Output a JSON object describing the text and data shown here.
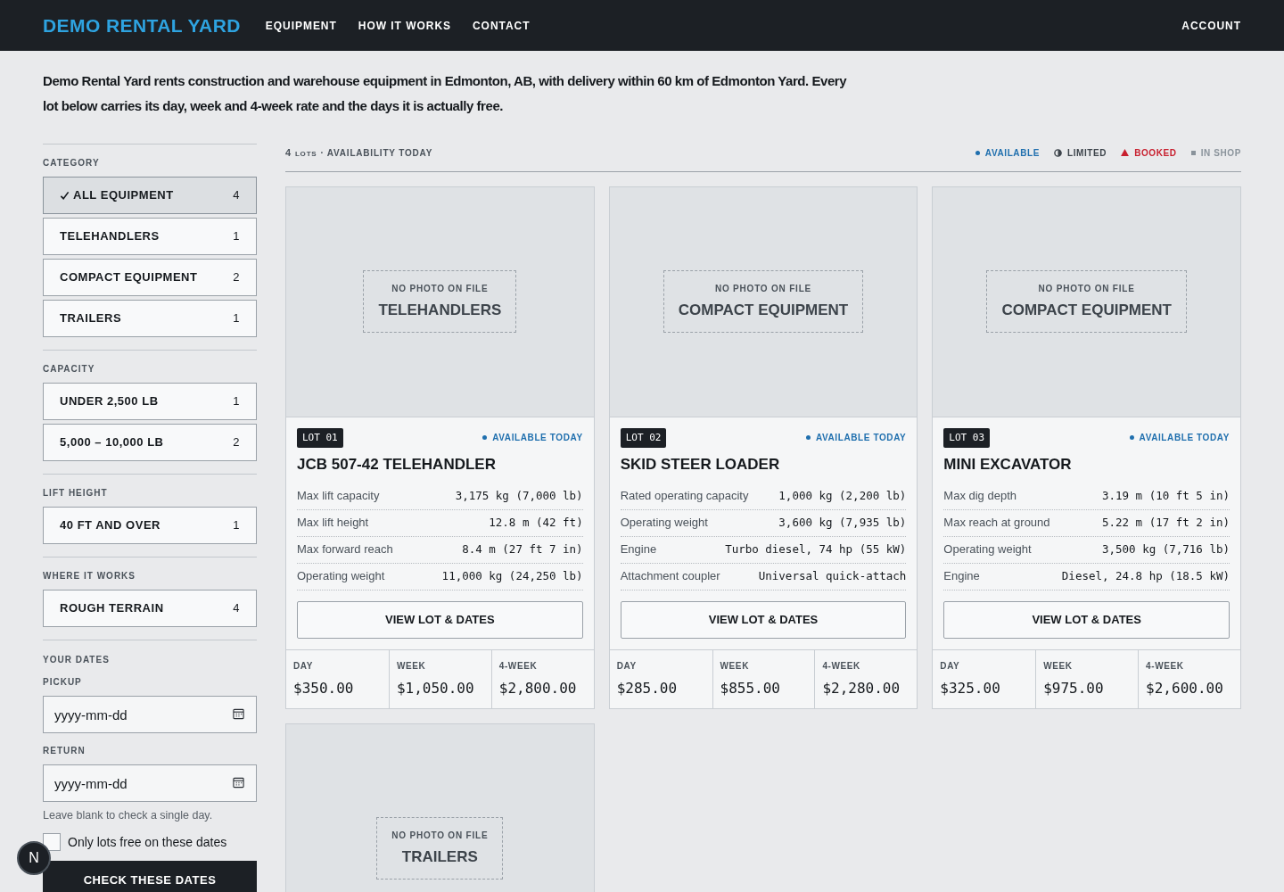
{
  "header": {
    "brand": "DEMO RENTAL YARD",
    "nav": [
      {
        "label": "EQUIPMENT"
      },
      {
        "label": "HOW IT WORKS"
      },
      {
        "label": "CONTACT"
      }
    ],
    "account": "ACCOUNT"
  },
  "intro": "Demo Rental Yard rents construction and warehouse equipment in Edmonton, AB, with delivery within 60 km of Edmonton Yard. Every lot below carries its day, week and 4-week rate and the days it is actually free.",
  "filters": [
    {
      "title": "CATEGORY",
      "options": [
        {
          "label": "ALL EQUIPMENT",
          "count": "4",
          "selected": true
        },
        {
          "label": "TELEHANDLERS",
          "count": "1",
          "selected": false
        },
        {
          "label": "COMPACT EQUIPMENT",
          "count": "2",
          "selected": false
        },
        {
          "label": "TRAILERS",
          "count": "1",
          "selected": false
        }
      ]
    },
    {
      "title": "CAPACITY",
      "options": [
        {
          "label": "UNDER 2,500 LB",
          "count": "1",
          "selected": false
        },
        {
          "label": "5,000 – 10,000 LB",
          "count": "2",
          "selected": false
        }
      ]
    },
    {
      "title": "LIFT HEIGHT",
      "options": [
        {
          "label": "40 FT AND OVER",
          "count": "1",
          "selected": false
        }
      ]
    },
    {
      "title": "WHERE IT WORKS",
      "options": [
        {
          "label": "ROUGH TERRAIN",
          "count": "4",
          "selected": false
        }
      ]
    }
  ],
  "dates": {
    "title": "YOUR DATES",
    "pickup": {
      "label": "PICKUP",
      "placeholder": "yyyy-mm-dd"
    },
    "return": {
      "label": "RETURN",
      "placeholder": "yyyy-mm-dd"
    },
    "hint": "Leave blank to check a single day.",
    "only_free": {
      "label": "Only lots free on these dates",
      "checked": false
    },
    "button": "CHECK THESE DATES"
  },
  "dev_badge": "N",
  "results": {
    "count": "4",
    "count_unit": "LOTS",
    "heading": "· AVAILABILITY TODAY",
    "legend": [
      {
        "kind": "dot",
        "label": "AVAILABLE",
        "color": "#1f6fae"
      },
      {
        "kind": "half",
        "label": "LIMITED",
        "color": "#3d444b"
      },
      {
        "kind": "triangle",
        "label": "BOOKED",
        "color": "#c8202f"
      },
      {
        "kind": "square",
        "label": "IN SHOP",
        "color": "#8a939b"
      }
    ]
  },
  "lots": [
    {
      "photo_note": "NO PHOTO ON FILE",
      "photo_category": "TELEHANDLERS",
      "lot": "LOT 01",
      "status": "AVAILABLE TODAY",
      "name": "JCB 507-42 TELEHANDLER",
      "specs": [
        {
          "label": "Max lift capacity",
          "value": "3,175 kg (7,000 lb)"
        },
        {
          "label": "Max lift height",
          "value": "12.8 m (42 ft)"
        },
        {
          "label": "Max forward reach",
          "value": "8.4 m (27 ft 7 in)"
        },
        {
          "label": "Operating weight",
          "value": "11,000 kg (24,250 lb)"
        }
      ],
      "button": "VIEW LOT & DATES",
      "rates": [
        {
          "label": "DAY",
          "price": "$350.00"
        },
        {
          "label": "WEEK",
          "price": "$1,050.00"
        },
        {
          "label": "4-WEEK",
          "price": "$2,800.00"
        }
      ]
    },
    {
      "photo_note": "NO PHOTO ON FILE",
      "photo_category": "COMPACT EQUIPMENT",
      "lot": "LOT 02",
      "status": "AVAILABLE TODAY",
      "name": "SKID STEER LOADER",
      "specs": [
        {
          "label": "Rated operating capacity",
          "value": "1,000 kg (2,200 lb)"
        },
        {
          "label": "Operating weight",
          "value": "3,600 kg (7,935 lb)"
        },
        {
          "label": "Engine",
          "value": "Turbo diesel, 74 hp (55 kW)"
        },
        {
          "label": "Attachment coupler",
          "value": "Universal quick-attach"
        }
      ],
      "button": "VIEW LOT & DATES",
      "rates": [
        {
          "label": "DAY",
          "price": "$285.00"
        },
        {
          "label": "WEEK",
          "price": "$855.00"
        },
        {
          "label": "4-WEEK",
          "price": "$2,280.00"
        }
      ]
    },
    {
      "photo_note": "NO PHOTO ON FILE",
      "photo_category": "COMPACT EQUIPMENT",
      "lot": "LOT 03",
      "status": "AVAILABLE TODAY",
      "name": "MINI EXCAVATOR",
      "specs": [
        {
          "label": "Max dig depth",
          "value": "3.19 m (10 ft 5 in)"
        },
        {
          "label": "Max reach at ground",
          "value": "5.22 m (17 ft 2 in)"
        },
        {
          "label": "Operating weight",
          "value": "3,500 kg (7,716 lb)"
        },
        {
          "label": "Engine",
          "value": "Diesel, 24.8 hp (18.5 kW)"
        }
      ],
      "button": "VIEW LOT & DATES",
      "rates": [
        {
          "label": "DAY",
          "price": "$325.00"
        },
        {
          "label": "WEEK",
          "price": "$975.00"
        },
        {
          "label": "4-WEEK",
          "price": "$2,600.00"
        }
      ]
    },
    {
      "photo_note": "NO PHOTO ON FILE",
      "photo_category": "TRAILERS"
    }
  ]
}
